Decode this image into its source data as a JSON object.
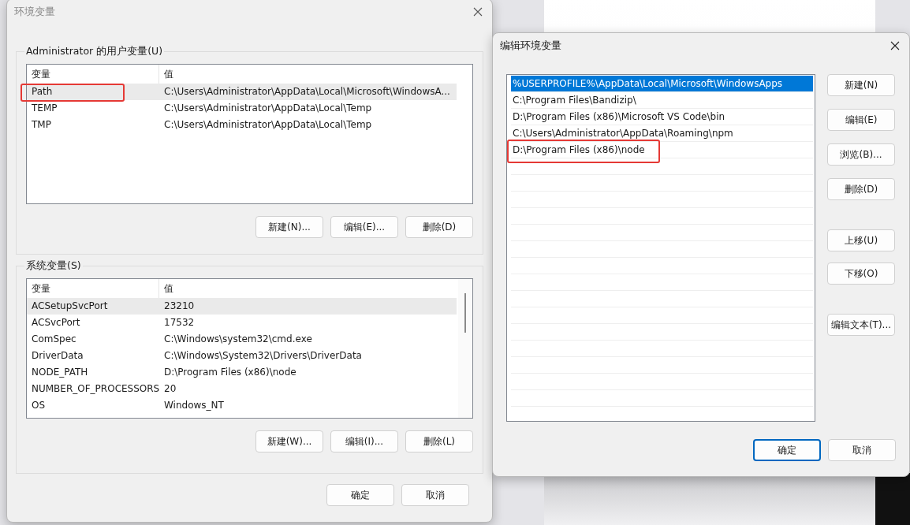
{
  "env_dialog": {
    "title": "环境变量",
    "user_vars": {
      "label": "Administrator 的用户变量(U)",
      "columns": [
        "变量",
        "值"
      ],
      "rows": [
        {
          "name": "Path",
          "value": "C:\\Users\\Administrator\\AppData\\Local\\Microsoft\\WindowsA...",
          "selected": true,
          "highlighted": true
        },
        {
          "name": "TEMP",
          "value": "C:\\Users\\Administrator\\AppData\\Local\\Temp",
          "selected": false,
          "highlighted": false
        },
        {
          "name": "TMP",
          "value": "C:\\Users\\Administrator\\AppData\\Local\\Temp",
          "selected": false,
          "highlighted": false
        }
      ],
      "buttons": [
        "新建(N)...",
        "编辑(E)...",
        "删除(D)"
      ]
    },
    "system_vars": {
      "label": "系统变量(S)",
      "columns": [
        "变量",
        "值"
      ],
      "rows": [
        {
          "name": "ACSetupSvcPort",
          "value": "23210",
          "selected": true,
          "highlighted": false
        },
        {
          "name": "ACSvcPort",
          "value": "17532",
          "selected": false,
          "highlighted": false
        },
        {
          "name": "ComSpec",
          "value": "C:\\Windows\\system32\\cmd.exe",
          "selected": false,
          "highlighted": false
        },
        {
          "name": "DriverData",
          "value": "C:\\Windows\\System32\\Drivers\\DriverData",
          "selected": false,
          "highlighted": false
        },
        {
          "name": "NODE_PATH",
          "value": "D:\\Program Files (x86)\\node",
          "selected": false,
          "highlighted": false
        },
        {
          "name": "NUMBER_OF_PROCESSORS",
          "value": "20",
          "selected": false,
          "highlighted": false
        },
        {
          "name": "OS",
          "value": "Windows_NT",
          "selected": false,
          "highlighted": false
        }
      ],
      "buttons": [
        "新建(W)...",
        "编辑(I)...",
        "删除(L)"
      ]
    },
    "footer_buttons": [
      {
        "label": "确定",
        "default": false
      },
      {
        "label": "取消",
        "default": false
      }
    ]
  },
  "edit_dialog": {
    "title": "编辑环境变量",
    "entries": [
      {
        "text": "%USERPROFILE%\\AppData\\Local\\Microsoft\\WindowsApps",
        "selected": true,
        "highlighted": false
      },
      {
        "text": "C:\\Program Files\\Bandizip\\",
        "selected": false,
        "highlighted": false
      },
      {
        "text": "D:\\Program Files (x86)\\Microsoft VS Code\\bin",
        "selected": false,
        "highlighted": false
      },
      {
        "text": "C:\\Users\\Administrator\\AppData\\Roaming\\npm",
        "selected": false,
        "highlighted": false
      },
      {
        "text": "D:\\Program Files (x86)\\node",
        "selected": false,
        "highlighted": true
      }
    ],
    "side_buttons": [
      "新建(N)",
      "编辑(E)",
      "浏览(B)...",
      "删除(D)",
      "上移(U)",
      "下移(O)",
      "编辑文本(T)..."
    ],
    "footer_buttons": [
      {
        "label": "确定",
        "default": true
      },
      {
        "label": "取消",
        "default": false
      }
    ]
  }
}
